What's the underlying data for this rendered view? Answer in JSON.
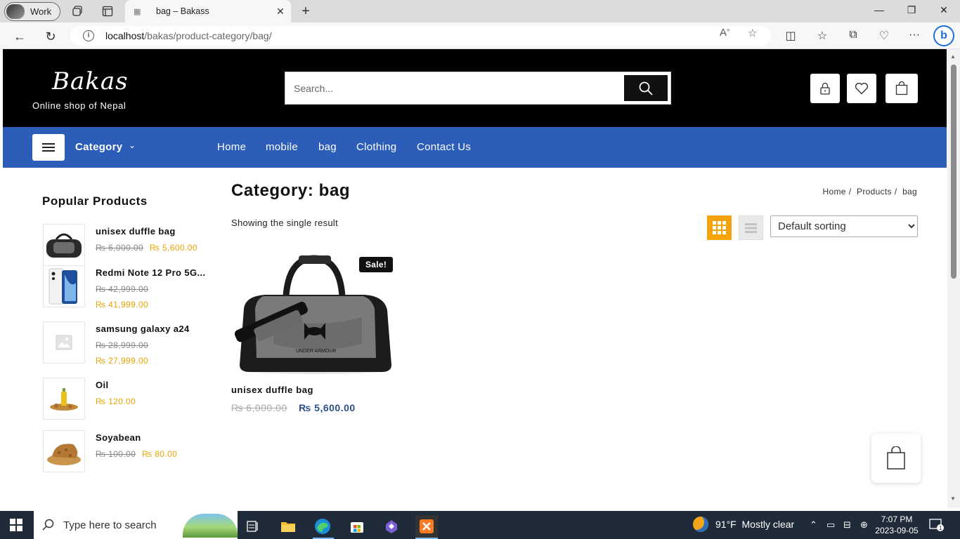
{
  "browser": {
    "profile_label": "Work",
    "tab_title": "bag – Bakass",
    "url_host": "localhost",
    "url_path": "/bakas/product-category/bag/"
  },
  "site": {
    "logo": "Bakas",
    "tagline": "Online shop of Nepal",
    "search_placeholder": "Search...",
    "nav": {
      "category_label": "Category",
      "links": [
        "Home",
        "mobile",
        "bag",
        "Clothing",
        "Contact Us"
      ]
    }
  },
  "sidebar": {
    "title": "Popular Products",
    "items": [
      {
        "name": "unisex duffle bag",
        "old_price": "₨ 6,000.00",
        "new_price": "₨ 5,600.00"
      },
      {
        "name": "Redmi Note 12 Pro 5G...",
        "old_price": "₨ 42,999.00",
        "new_price": "₨ 41,999.00"
      },
      {
        "name": "samsung galaxy a24",
        "old_price": "₨ 28,999.00",
        "new_price": "₨ 27,999.00"
      },
      {
        "name": "Oil",
        "old_price": "",
        "new_price": "₨ 120.00"
      },
      {
        "name": "Soyabean",
        "old_price": "₨ 100.00",
        "new_price": "₨ 80.00"
      }
    ]
  },
  "main": {
    "title": "Category: bag",
    "breadcrumb": [
      "Home",
      "/",
      "Products",
      "/",
      "bag"
    ],
    "result_count": "Showing the single result",
    "sorting_selected": "Default sorting",
    "product": {
      "badge": "Sale!",
      "name": "unisex duffle bag",
      "old_price": "₨ 6,000.00",
      "new_price": "₨ 5,600.00"
    }
  },
  "taskbar": {
    "search_placeholder": "Type here to search",
    "weather_temp": "91°F",
    "weather_desc": "Mostly clear",
    "time": "7:07 PM",
    "date": "2023-09-05",
    "notification_count": "1"
  },
  "colors": {
    "header_bg": "#000000",
    "nav_bg": "#2c5db8",
    "accent_orange": "#f5a30a",
    "price_new_sidebar": "#e8a400",
    "price_new_main": "#2c4f8c"
  }
}
